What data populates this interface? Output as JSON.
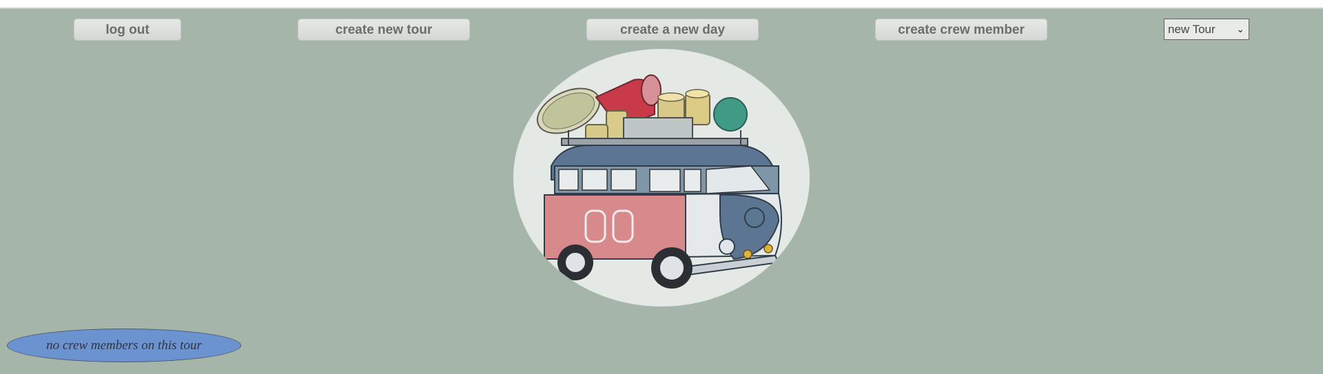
{
  "nav": {
    "logout_label": "log out",
    "create_tour_label": "create new tour",
    "create_day_label": "create a new day",
    "create_crew_label": "create crew member"
  },
  "tour_select": {
    "selected": "new Tour"
  },
  "crew": {
    "empty_message": "no crew members on this tour"
  },
  "colors": {
    "background": "#a6b5a9",
    "button": "#dfe2df",
    "pill": "#6b93cf"
  }
}
